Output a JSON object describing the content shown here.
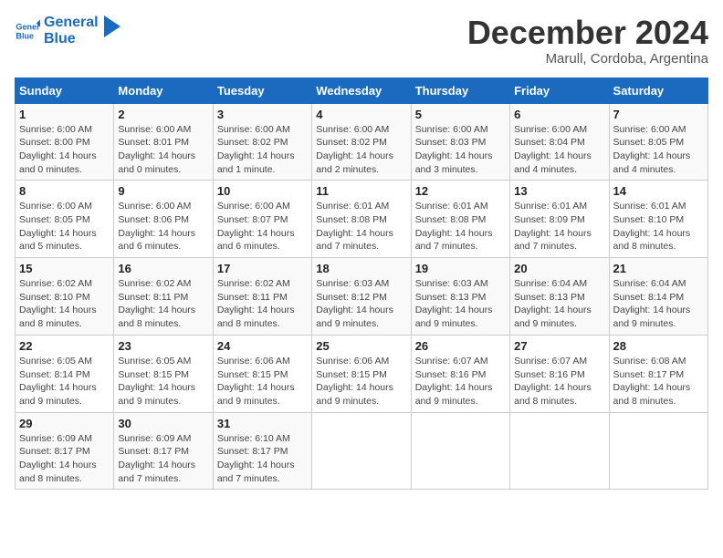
{
  "header": {
    "logo_line1": "General",
    "logo_line2": "Blue",
    "month": "December 2024",
    "location": "Marull, Cordoba, Argentina"
  },
  "days_of_week": [
    "Sunday",
    "Monday",
    "Tuesday",
    "Wednesday",
    "Thursday",
    "Friday",
    "Saturday"
  ],
  "weeks": [
    [
      {
        "day": "1",
        "info": "Sunrise: 6:00 AM\nSunset: 8:00 PM\nDaylight: 14 hours\nand 0 minutes."
      },
      {
        "day": "2",
        "info": "Sunrise: 6:00 AM\nSunset: 8:01 PM\nDaylight: 14 hours\nand 0 minutes."
      },
      {
        "day": "3",
        "info": "Sunrise: 6:00 AM\nSunset: 8:02 PM\nDaylight: 14 hours\nand 1 minute."
      },
      {
        "day": "4",
        "info": "Sunrise: 6:00 AM\nSunset: 8:02 PM\nDaylight: 14 hours\nand 2 minutes."
      },
      {
        "day": "5",
        "info": "Sunrise: 6:00 AM\nSunset: 8:03 PM\nDaylight: 14 hours\nand 3 minutes."
      },
      {
        "day": "6",
        "info": "Sunrise: 6:00 AM\nSunset: 8:04 PM\nDaylight: 14 hours\nand 4 minutes."
      },
      {
        "day": "7",
        "info": "Sunrise: 6:00 AM\nSunset: 8:05 PM\nDaylight: 14 hours\nand 4 minutes."
      }
    ],
    [
      {
        "day": "8",
        "info": "Sunrise: 6:00 AM\nSunset: 8:05 PM\nDaylight: 14 hours\nand 5 minutes."
      },
      {
        "day": "9",
        "info": "Sunrise: 6:00 AM\nSunset: 8:06 PM\nDaylight: 14 hours\nand 6 minutes."
      },
      {
        "day": "10",
        "info": "Sunrise: 6:00 AM\nSunset: 8:07 PM\nDaylight: 14 hours\nand 6 minutes."
      },
      {
        "day": "11",
        "info": "Sunrise: 6:01 AM\nSunset: 8:08 PM\nDaylight: 14 hours\nand 7 minutes."
      },
      {
        "day": "12",
        "info": "Sunrise: 6:01 AM\nSunset: 8:08 PM\nDaylight: 14 hours\nand 7 minutes."
      },
      {
        "day": "13",
        "info": "Sunrise: 6:01 AM\nSunset: 8:09 PM\nDaylight: 14 hours\nand 7 minutes."
      },
      {
        "day": "14",
        "info": "Sunrise: 6:01 AM\nSunset: 8:10 PM\nDaylight: 14 hours\nand 8 minutes."
      }
    ],
    [
      {
        "day": "15",
        "info": "Sunrise: 6:02 AM\nSunset: 8:10 PM\nDaylight: 14 hours\nand 8 minutes."
      },
      {
        "day": "16",
        "info": "Sunrise: 6:02 AM\nSunset: 8:11 PM\nDaylight: 14 hours\nand 8 minutes."
      },
      {
        "day": "17",
        "info": "Sunrise: 6:02 AM\nSunset: 8:11 PM\nDaylight: 14 hours\nand 8 minutes."
      },
      {
        "day": "18",
        "info": "Sunrise: 6:03 AM\nSunset: 8:12 PM\nDaylight: 14 hours\nand 9 minutes."
      },
      {
        "day": "19",
        "info": "Sunrise: 6:03 AM\nSunset: 8:13 PM\nDaylight: 14 hours\nand 9 minutes."
      },
      {
        "day": "20",
        "info": "Sunrise: 6:04 AM\nSunset: 8:13 PM\nDaylight: 14 hours\nand 9 minutes."
      },
      {
        "day": "21",
        "info": "Sunrise: 6:04 AM\nSunset: 8:14 PM\nDaylight: 14 hours\nand 9 minutes."
      }
    ],
    [
      {
        "day": "22",
        "info": "Sunrise: 6:05 AM\nSunset: 8:14 PM\nDaylight: 14 hours\nand 9 minutes."
      },
      {
        "day": "23",
        "info": "Sunrise: 6:05 AM\nSunset: 8:15 PM\nDaylight: 14 hours\nand 9 minutes."
      },
      {
        "day": "24",
        "info": "Sunrise: 6:06 AM\nSunset: 8:15 PM\nDaylight: 14 hours\nand 9 minutes."
      },
      {
        "day": "25",
        "info": "Sunrise: 6:06 AM\nSunset: 8:15 PM\nDaylight: 14 hours\nand 9 minutes."
      },
      {
        "day": "26",
        "info": "Sunrise: 6:07 AM\nSunset: 8:16 PM\nDaylight: 14 hours\nand 9 minutes."
      },
      {
        "day": "27",
        "info": "Sunrise: 6:07 AM\nSunset: 8:16 PM\nDaylight: 14 hours\nand 8 minutes."
      },
      {
        "day": "28",
        "info": "Sunrise: 6:08 AM\nSunset: 8:17 PM\nDaylight: 14 hours\nand 8 minutes."
      }
    ],
    [
      {
        "day": "29",
        "info": "Sunrise: 6:09 AM\nSunset: 8:17 PM\nDaylight: 14 hours\nand 8 minutes."
      },
      {
        "day": "30",
        "info": "Sunrise: 6:09 AM\nSunset: 8:17 PM\nDaylight: 14 hours\nand 7 minutes."
      },
      {
        "day": "31",
        "info": "Sunrise: 6:10 AM\nSunset: 8:17 PM\nDaylight: 14 hours\nand 7 minutes."
      },
      {
        "day": "",
        "info": ""
      },
      {
        "day": "",
        "info": ""
      },
      {
        "day": "",
        "info": ""
      },
      {
        "day": "",
        "info": ""
      }
    ]
  ]
}
